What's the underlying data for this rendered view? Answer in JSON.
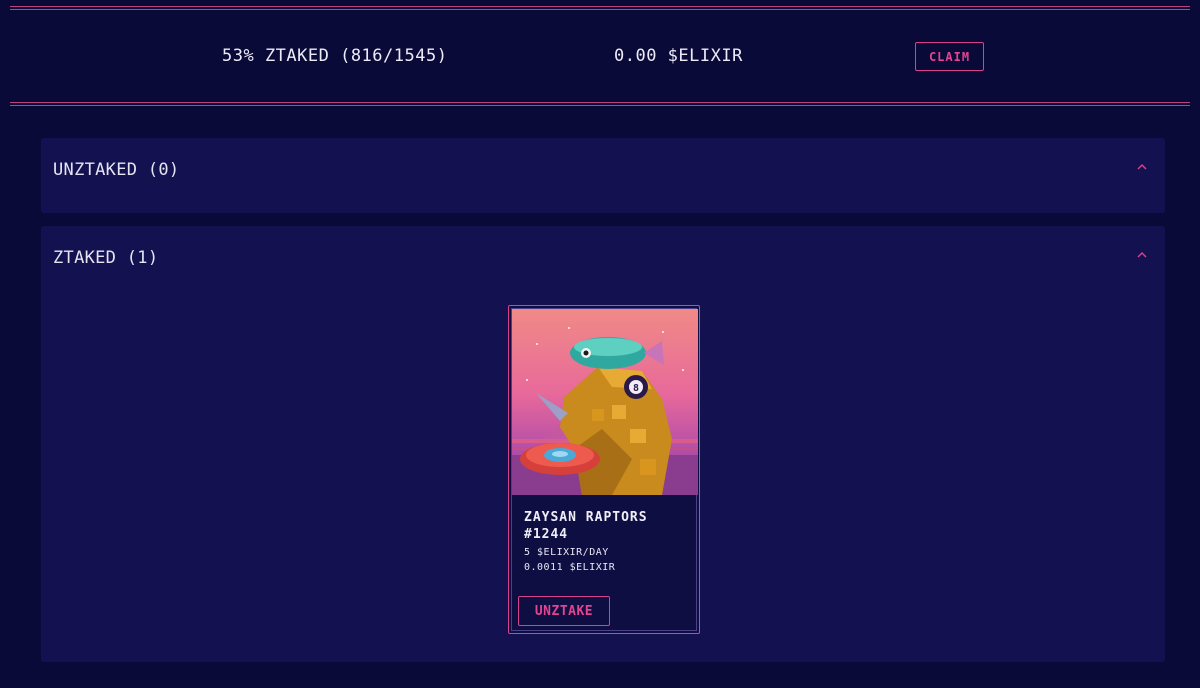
{
  "stats": {
    "ztaked_text": "53% ZTAKED (816/1545)",
    "elixir_balance": "0.00 $ELIXIR",
    "claim_label": "CLAIM"
  },
  "unztaked_panel": {
    "title": "UNZTAKED (0)",
    "icon": "chevron-up-icon"
  },
  "ztaked_panel": {
    "title": "ZTAKED (1)",
    "icon": "chevron-up-icon",
    "items": [
      {
        "name": "ZAYSAN RAPTORS #1244",
        "rate": "5 $ELIXIR/DAY",
        "earned": "0.0011 $ELIXIR",
        "action_label": "UNZTAKE"
      }
    ]
  },
  "colors": {
    "background": "#0a0a38",
    "panel": "#131150",
    "accent": "#d9418b",
    "text": "#ecebf7"
  }
}
